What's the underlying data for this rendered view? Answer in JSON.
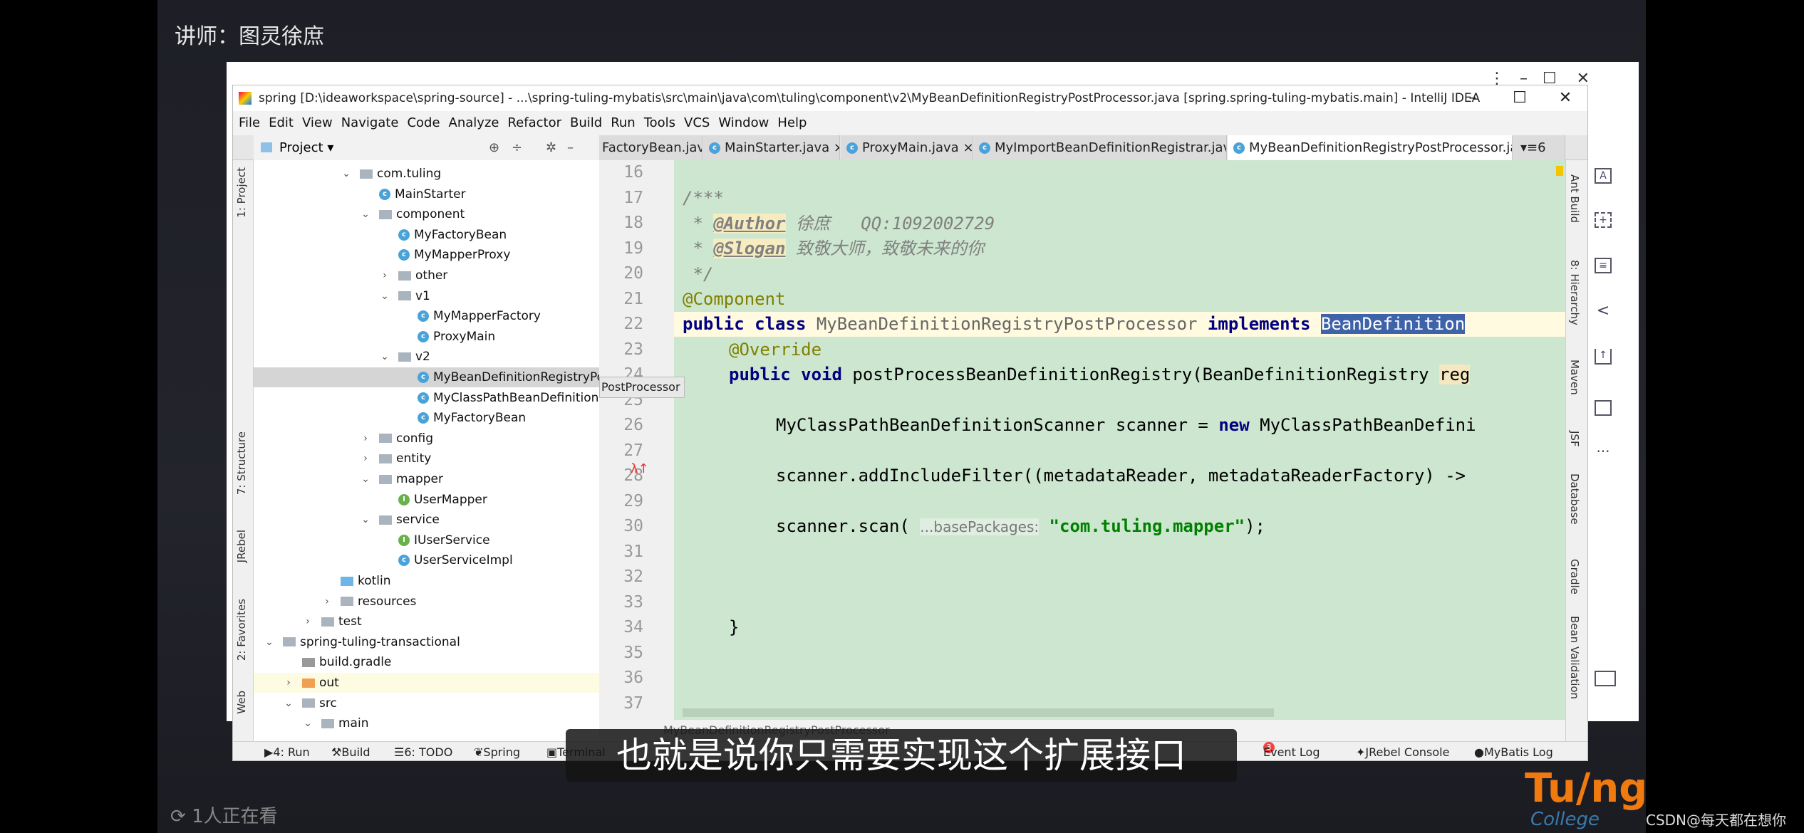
{
  "overlay": {
    "lecturer": "讲师：图灵徐庶",
    "subtitle": "也就是说你只需要实现这个扩展接口",
    "viewers": "1人正在看",
    "logo_text": "Turing College",
    "watermark": "CSDN@每天都在想你"
  },
  "window": {
    "title": "spring [D:\\ideaworkspace\\spring-source] - ...\\spring-tuling-mybatis\\src\\main\\java\\com\\tuling\\component\\v2\\MyBeanDefinitionRegistryPostProcessor.java [spring.spring-tuling-mybatis.main] - IntelliJ IDEA",
    "minimize": "–",
    "maximize": "☐",
    "close": "✕"
  },
  "menu": [
    "File",
    "Edit",
    "View",
    "Navigate",
    "Code",
    "Analyze",
    "Refactor",
    "Build",
    "Run",
    "Tools",
    "VCS",
    "Window",
    "Help"
  ],
  "project_panel": {
    "title": "Project"
  },
  "tabs": [
    {
      "label": "FactoryBean.java"
    },
    {
      "label": "MainStarter.java"
    },
    {
      "label": "ProxyMain.java"
    },
    {
      "label": "MyImportBeanDefinitionRegistrar.java"
    },
    {
      "label": "MyBeanDefinitionRegistryPostProcessor.java",
      "active": true
    }
  ],
  "tab_overflow": "6",
  "left_tools": [
    "1: Project",
    "7: Structure",
    "JRebel",
    "2: Favorites",
    "Web"
  ],
  "right_tools": [
    "Ant Build",
    "8: Hierarchy",
    "Maven",
    "JSF",
    "Database",
    "Gradle",
    "Bean Validation"
  ],
  "tree": [
    {
      "label": "com.tuling",
      "type": "folder",
      "indent": 5,
      "expanded": true
    },
    {
      "label": "MainStarter",
      "type": "class",
      "indent": 6
    },
    {
      "label": "component",
      "type": "folder",
      "indent": 6,
      "expanded": true
    },
    {
      "label": "MyFactoryBean",
      "type": "class",
      "indent": 7
    },
    {
      "label": "MyMapperProxy",
      "type": "class",
      "indent": 7
    },
    {
      "label": "other",
      "type": "folder",
      "indent": 7,
      "expanded": false
    },
    {
      "label": "v1",
      "type": "folder",
      "indent": 7,
      "expanded": true
    },
    {
      "label": "MyMapperFactory",
      "type": "class",
      "indent": 8
    },
    {
      "label": "ProxyMain",
      "type": "class",
      "indent": 8
    },
    {
      "label": "v2",
      "type": "folder",
      "indent": 7,
      "expanded": true
    },
    {
      "label": "MyBeanDefinitionRegistryPostProcessor",
      "type": "class",
      "indent": 8,
      "selected": true
    },
    {
      "label": "MyClassPathBeanDefinition",
      "type": "class",
      "indent": 8
    },
    {
      "label": "MyFactoryBean",
      "type": "class",
      "indent": 8
    },
    {
      "label": "config",
      "type": "folder",
      "indent": 6,
      "expanded": false
    },
    {
      "label": "entity",
      "type": "folder",
      "indent": 6,
      "expanded": false
    },
    {
      "label": "mapper",
      "type": "folder",
      "indent": 6,
      "expanded": true
    },
    {
      "label": "UserMapper",
      "type": "interface",
      "indent": 7
    },
    {
      "label": "service",
      "type": "folder",
      "indent": 6,
      "expanded": true
    },
    {
      "label": "IUserService",
      "type": "interface",
      "indent": 7
    },
    {
      "label": "UserServiceImpl",
      "type": "class",
      "indent": 7
    },
    {
      "label": "kotlin",
      "type": "folder-blue",
      "indent": 4
    },
    {
      "label": "resources",
      "type": "folder",
      "indent": 4,
      "expanded": false
    },
    {
      "label": "test",
      "type": "folder",
      "indent": 3,
      "expanded": false
    },
    {
      "label": "spring-tuling-transactional",
      "type": "folder",
      "indent": 1,
      "expanded": true
    },
    {
      "label": "build.gradle",
      "type": "file",
      "indent": 2
    },
    {
      "label": "out",
      "type": "folder-orange",
      "indent": 2,
      "expanded": false,
      "highlighted": true
    },
    {
      "label": "src",
      "type": "folder",
      "indent": 2,
      "expanded": true
    },
    {
      "label": "main",
      "type": "folder",
      "indent": 3,
      "expanded": true
    }
  ],
  "code": {
    "line_numbers": [
      "16",
      "17",
      "18",
      "19",
      "20",
      "21",
      "22",
      "23",
      "24",
      "25",
      "26",
      "27",
      "28",
      "29",
      "30",
      "31",
      "32",
      "33",
      "34",
      "35",
      "36",
      "37"
    ],
    "lines": {
      "l17": "/***",
      "l18_star": " * ",
      "l18_tag": "@Author",
      "l18_text": " 徐庶   QQ:1092002729",
      "l19_star": " * ",
      "l19_tag": "@Slogan",
      "l19_text": " 致敬大师，致敬未来的你",
      "l20": " */",
      "l21": "@Component",
      "l22_kw": "public class ",
      "l22_name": "MyBeanDefinitionRegistryPostProcessor ",
      "l22_kw2": "implements ",
      "l22_sel": "BeanDefinition",
      "l23": "@Override",
      "l24_kw": "public void ",
      "l24_text": "postProcessBeanDefinitionRegistry(BeanDefinitionRegistry ",
      "l24_param": "reg",
      "l26_text": "MyClassPathBeanDefinitionScanner scanner = ",
      "l26_kw": "new ",
      "l26_text2": "MyClassPathBeanDefini",
      "l28": "scanner.addIncludeFilter((metadataReader, metadataReaderFactory) -> ",
      "l30_a": "scanner.scan( ",
      "l30_hint": "...basePackages:",
      "l30_str": " \"com.tuling.mapper\"",
      "l30_b": ");",
      "l34": "}"
    },
    "tooltip": "PostProcessor"
  },
  "breadcrumb": "MyBeanDefinitionRegistryPostProcessor",
  "statusbar": {
    "left": [
      "4: Run",
      "Build",
      "6: TODO",
      "Spring",
      "Terminal"
    ],
    "right": [
      "Event Log",
      "JRebel Console",
      "MyBatis Log"
    ],
    "event_count": "3"
  },
  "colors": {
    "editor_bg": "#cce6cf",
    "selection": "#3f63a8",
    "accent": "#f07a10"
  }
}
